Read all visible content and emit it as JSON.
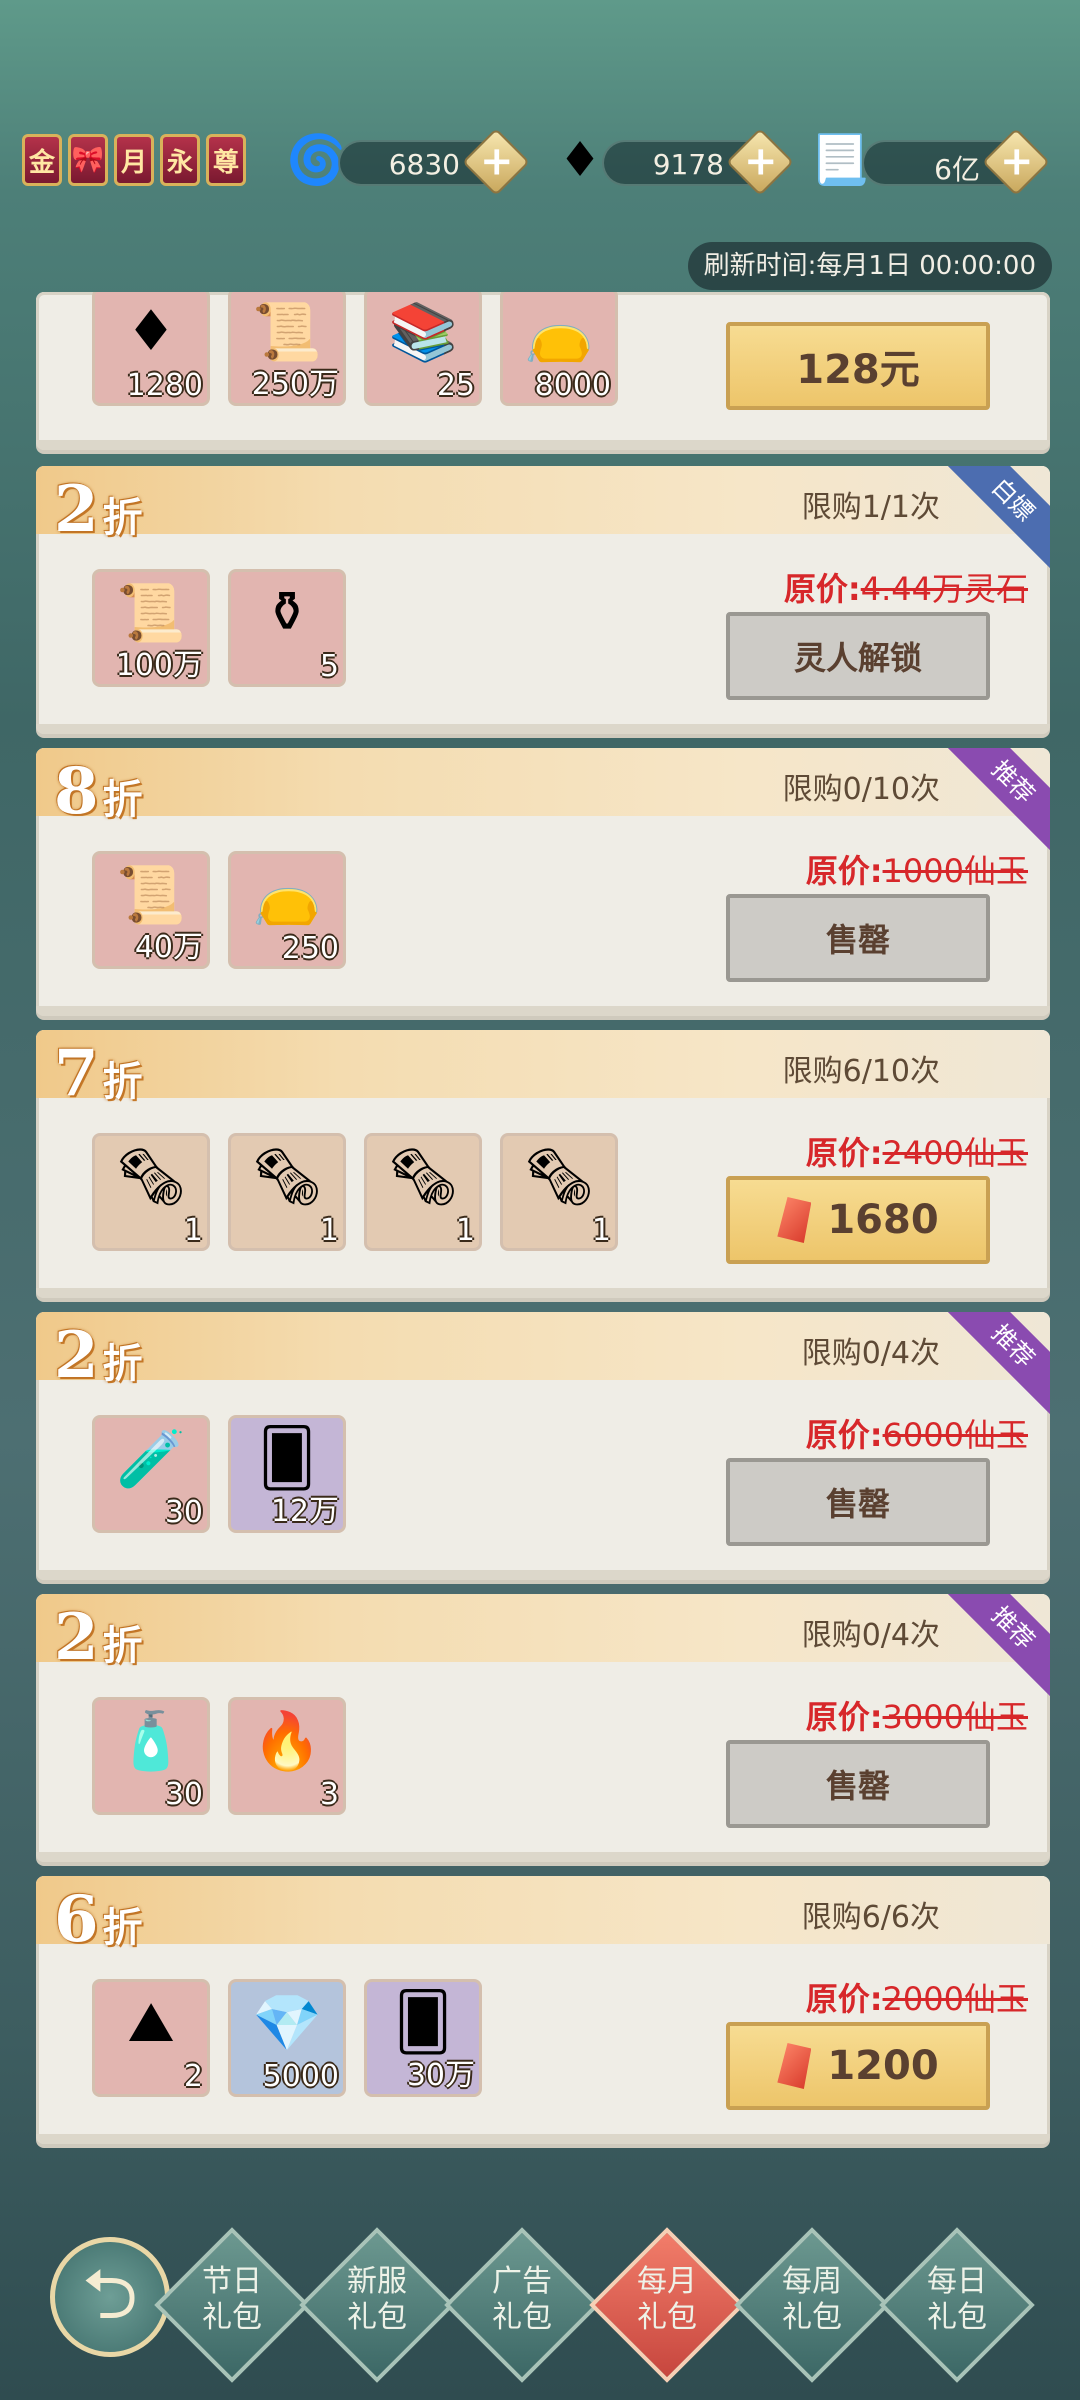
{
  "vip_badges": [
    {
      "label": "金"
    },
    {
      "label": "🎀"
    },
    {
      "label": "月"
    },
    {
      "label": "永"
    },
    {
      "label": "尊"
    }
  ],
  "resources": [
    {
      "icon": "swirl-orb-icon",
      "value": "6830"
    },
    {
      "icon": "red-jade-icon",
      "value": "9178"
    },
    {
      "icon": "paper-talisman-icon",
      "value": "6亿"
    }
  ],
  "refresh_text": "刷新时间:每月1日 00:00:00",
  "top_partial": {
    "price_button": "128元",
    "items": [
      {
        "icon": "red-jade-icon",
        "count": "1280",
        "bg": "red"
      },
      {
        "icon": "scroll-icon",
        "count": "250万",
        "bg": "red"
      },
      {
        "icon": "book-stack-icon",
        "count": "25",
        "bg": "red"
      },
      {
        "icon": "pouch-icon",
        "count": "8000",
        "bg": "red"
      }
    ]
  },
  "packs": [
    {
      "discount_num": "2",
      "discount_unit": "折",
      "limit": "限购1/1次",
      "ribbon": "白嫖",
      "ribbon_color": "blue",
      "orig_label": "原价:",
      "orig_value": "4.44万灵石",
      "button": "灵人解锁",
      "button_style": "gray",
      "items": [
        {
          "icon": "scroll-icon",
          "count": "100万",
          "bg": "red"
        },
        {
          "icon": "potion-icon",
          "count": "5",
          "bg": "red"
        }
      ]
    },
    {
      "discount_num": "8",
      "discount_unit": "折",
      "limit": "限购0/10次",
      "ribbon": "推荐",
      "ribbon_color": "purple",
      "orig_label": "原价:",
      "orig_value": "1000仙玉",
      "button": "售罄",
      "button_style": "gray",
      "items": [
        {
          "icon": "scroll-icon",
          "count": "40万",
          "bg": "red"
        },
        {
          "icon": "pouch-icon",
          "count": "250",
          "bg": "red"
        }
      ]
    },
    {
      "discount_num": "7",
      "discount_unit": "折",
      "limit": "限购6/10次",
      "ribbon": "",
      "ribbon_color": "",
      "orig_label": "原价:",
      "orig_value": "2400仙玉",
      "button": "1680",
      "button_style": "gold",
      "items": [
        {
          "icon": "rolled-scroll-icon",
          "count": "1",
          "bg": "tan"
        },
        {
          "icon": "rolled-scroll-icon",
          "count": "1",
          "bg": "tan"
        },
        {
          "icon": "rolled-scroll-icon",
          "count": "1",
          "bg": "tan"
        },
        {
          "icon": "rolled-scroll-icon",
          "count": "1",
          "bg": "tan"
        }
      ]
    },
    {
      "discount_num": "2",
      "discount_unit": "折",
      "limit": "限购0/4次",
      "ribbon": "推荐",
      "ribbon_color": "purple",
      "orig_label": "原价:",
      "orig_value": "6000仙玉",
      "button": "售罄",
      "button_style": "gray",
      "items": [
        {
          "icon": "blue-flask-icon",
          "count": "30",
          "bg": "red"
        },
        {
          "icon": "card-icon",
          "count": "12万",
          "bg": "purple"
        }
      ]
    },
    {
      "discount_num": "2",
      "discount_unit": "折",
      "limit": "限购0/4次",
      "ribbon": "推荐",
      "ribbon_color": "purple",
      "orig_label": "原价:",
      "orig_value": "3000仙玉",
      "button": "售罄",
      "button_style": "gray",
      "items": [
        {
          "icon": "orange-flask-icon",
          "count": "30",
          "bg": "red"
        },
        {
          "icon": "flame-orb-icon",
          "count": "3",
          "bg": "red"
        }
      ]
    },
    {
      "discount_num": "6",
      "discount_unit": "折",
      "limit": "限购6/6次",
      "ribbon": "",
      "ribbon_color": "",
      "orig_label": "原价:",
      "orig_value": "2000仙玉",
      "button": "1200",
      "button_style": "gold",
      "items": [
        {
          "icon": "sand-pile-icon",
          "count": "2",
          "bg": "red"
        },
        {
          "icon": "crystal-pile-icon",
          "count": "5000",
          "bg": "blue"
        },
        {
          "icon": "card-icon",
          "count": "30万",
          "bg": "purple"
        }
      ]
    }
  ],
  "tabs": [
    {
      "l1": "节日",
      "l2": "礼包",
      "active": false
    },
    {
      "l1": "新服",
      "l2": "礼包",
      "active": false
    },
    {
      "l1": "广告",
      "l2": "礼包",
      "active": false
    },
    {
      "l1": "每月",
      "l2": "礼包",
      "active": true
    },
    {
      "l1": "每周",
      "l2": "礼包",
      "active": false
    },
    {
      "l1": "每日",
      "l2": "礼包",
      "active": false
    }
  ],
  "back_label": "返回"
}
